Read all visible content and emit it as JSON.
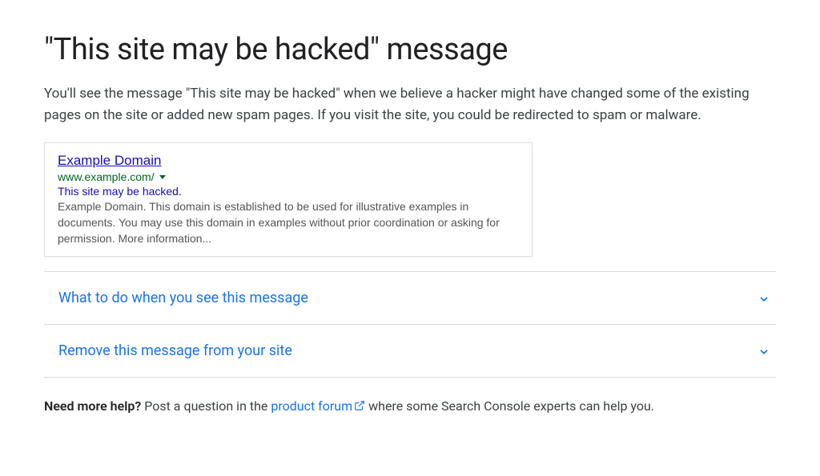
{
  "page_title": "\"This site may be hacked\" message",
  "intro_text": "You'll see the message \"This site may be hacked\" when we believe a hacker might have changed some of the existing pages on the site or added new spam pages. If you visit the site, you could be redirected to spam or malware.",
  "search_result": {
    "title": "Example Domain",
    "url": "www.example.com/",
    "warning": "This site may be hacked.",
    "description": "Example Domain. This domain is established to be used for illustrative examples in documents. You may use this domain in examples without prior coordination or asking for permission. More information..."
  },
  "accordion": [
    {
      "label": "What to do when you see this message"
    },
    {
      "label": "Remove this message from your site"
    }
  ],
  "footer": {
    "strong_text": "Need more help?",
    "before_link": " Post a question in the ",
    "link_text": "product forum",
    "after_link": "  where some Search Console experts can help you."
  }
}
